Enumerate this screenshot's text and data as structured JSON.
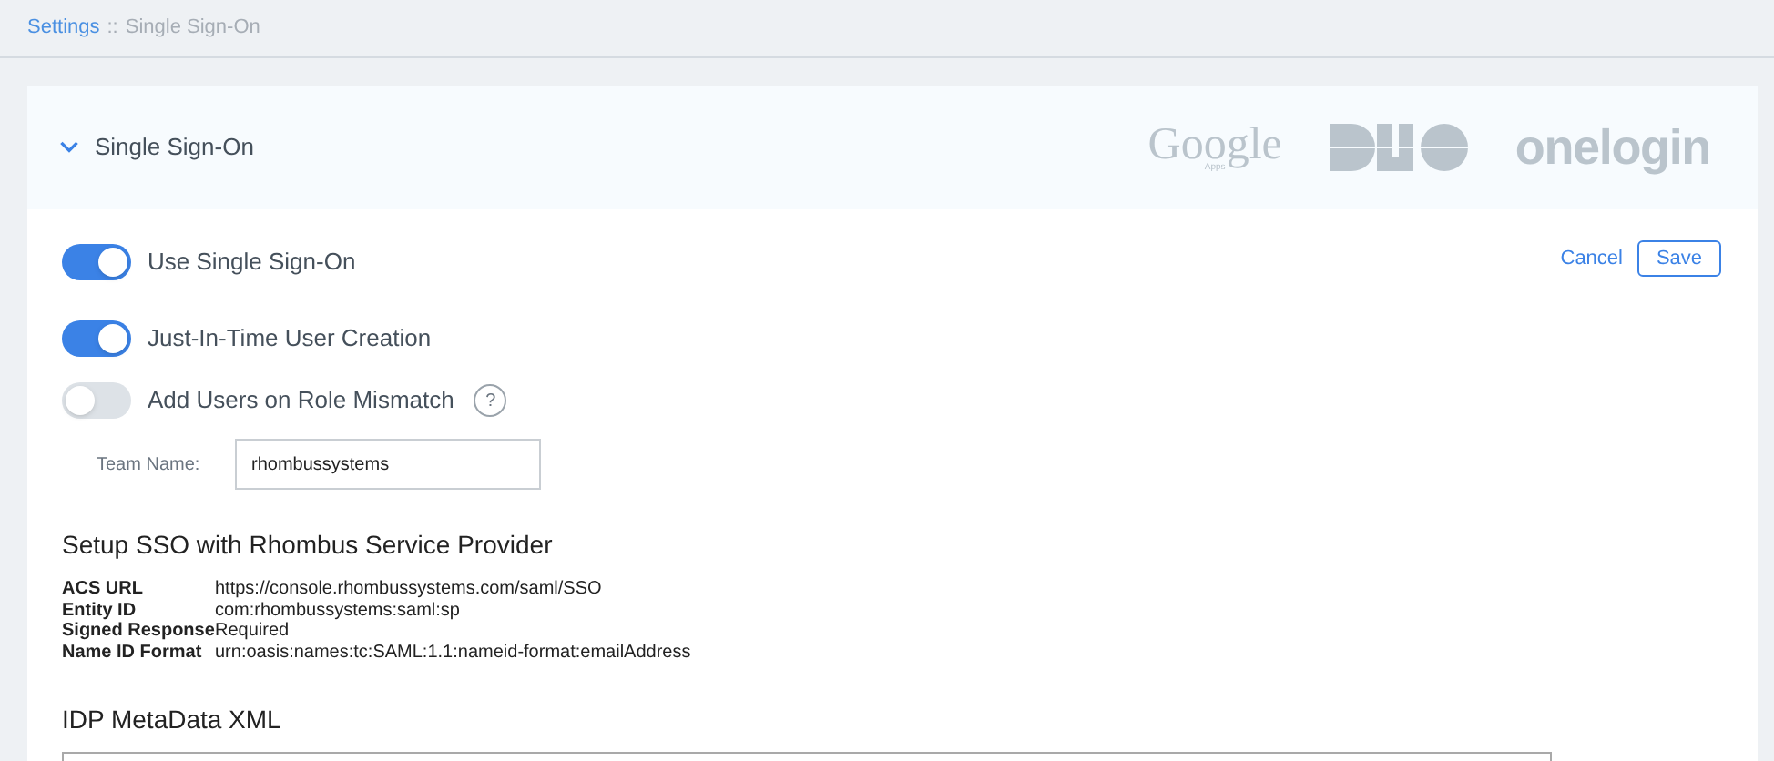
{
  "breadcrumb": {
    "link": "Settings",
    "separator": "::",
    "current": "Single Sign-On"
  },
  "panel": {
    "title": "Single Sign-On",
    "expanded": true,
    "providers": [
      {
        "kind": "google",
        "name": "Google",
        "sub": "Apps"
      },
      {
        "kind": "duo"
      },
      {
        "kind": "onelogin",
        "name": "onelogin"
      }
    ]
  },
  "actions": {
    "cancel": "Cancel",
    "save": "Save"
  },
  "toggles": [
    {
      "label": "Use Single Sign-On",
      "on": true
    },
    {
      "label": "Just-In-Time User Creation",
      "on": true
    },
    {
      "label": "Add Users on Role Mismatch",
      "on": false,
      "help_text": "?"
    }
  ],
  "team_name": {
    "label": "Team Name:",
    "value": "rhombussystems"
  },
  "sp_setup": {
    "title": "Setup SSO with Rhombus Service Provider",
    "rows": [
      {
        "key": "ACS URL",
        "value": "https://console.rhombussystems.com/saml/SSO"
      },
      {
        "key": "Entity ID",
        "value": "com:rhombussystems:saml:sp"
      },
      {
        "key": "Signed Response",
        "value": "Required"
      },
      {
        "key": "Name ID Format",
        "value": "urn:oasis:names:tc:SAML:1.1:nameid-format:emailAddress"
      }
    ]
  },
  "idp": {
    "title": "IDP MetaData XML"
  }
}
